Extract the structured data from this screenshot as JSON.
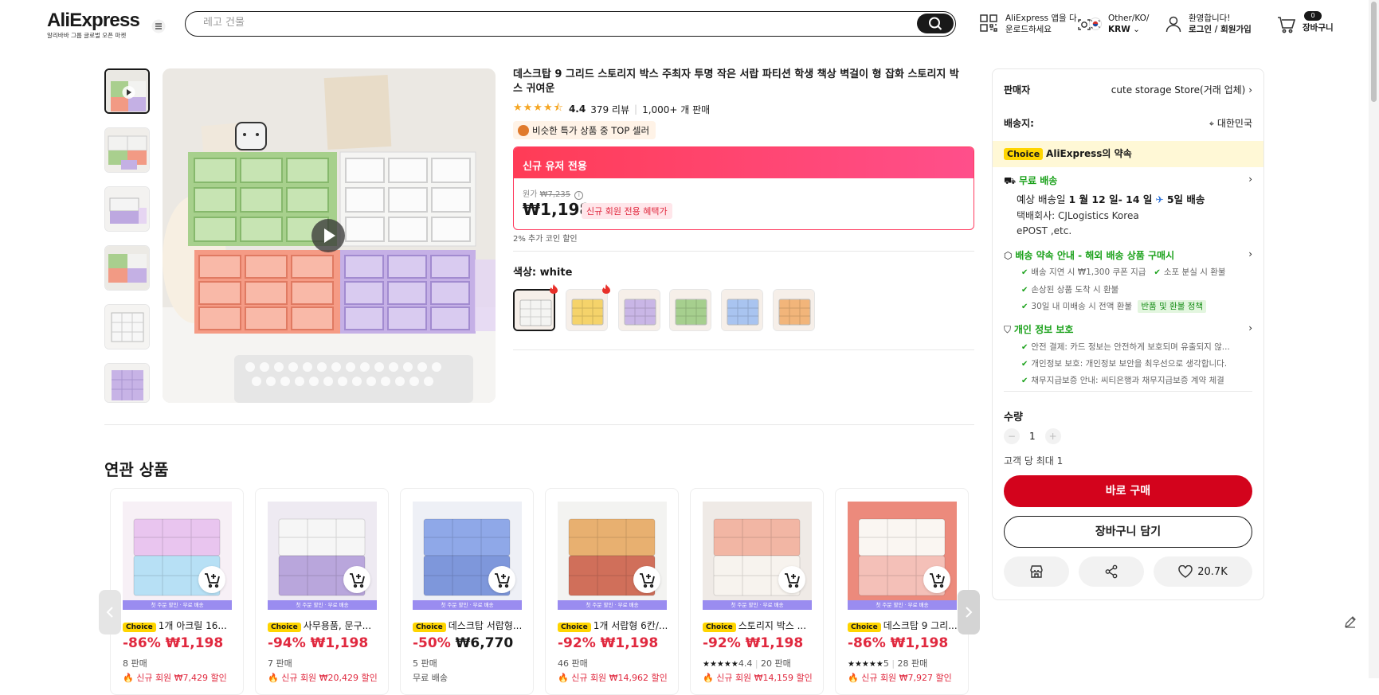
{
  "header": {
    "logo": "AliExpress",
    "logo_sub": "알리바바 그룹 글로벌 오픈 마켓",
    "search_placeholder": "레고 건물",
    "app_line1": "AliExpress 앱을 다",
    "app_line2": "운로드하세요",
    "region_line1": "Other/KO/",
    "region_line2": "KRW",
    "account_line1": "환영합니다!",
    "account_line2": "로그인 / 회원가입",
    "cart_count": "0",
    "cart_label": "장바구니"
  },
  "product": {
    "title": "데스크탑 9 그리드 스토리지 박스 주최자 투명 작은 서랍 파티션 학생 책상 벽걸이 형 잡화 스토리지 박스 귀여운",
    "rating": "4.4",
    "reviews": "379 리뷰",
    "sold": "1,000+ 개 판매",
    "top_seller": "비슷한 특가 상품 중 TOP 셀러",
    "promo_header": "신규 유저 전용",
    "orig_label": "원가",
    "orig_price": "₩7,235",
    "price": "₩1,198",
    "new_member_tag": "신규 회원 전용 혜택가",
    "coin_note": "2% 추가 코인 할인",
    "color_label": "색상: white",
    "swatches": [
      {
        "name": "white",
        "color": "#f4f4f2"
      },
      {
        "name": "yellow",
        "color": "#f5d36a"
      },
      {
        "name": "purple",
        "color": "#c9b6e6"
      },
      {
        "name": "green",
        "color": "#a6cf8e"
      },
      {
        "name": "blue",
        "color": "#a9c4f0"
      },
      {
        "name": "orange",
        "color": "#f2b57a"
      }
    ]
  },
  "panel": {
    "seller_label": "판매자",
    "seller_name": "cute storage Store(거래 업체)",
    "ship_to_label": "배송지:",
    "ship_to": "대한민국",
    "choice_badge": "Choice",
    "choice_promise": "AliExpress의 약속",
    "free_shipping": "무료 배송",
    "delivery_prefix": "예상 배송일 ",
    "delivery_dates": "1 월 12 일- 14 일",
    "delivery_speed": "5일 배송",
    "carrier_line1": "택배회사:  CJLogistics  Korea",
    "carrier_line2": "ePOST ,etc.",
    "guarantee_title": "배송 약속 안내 - 해외 배송 상품 구매시",
    "guarantees": [
      "배송 지연 시 ₩1,300 쿠폰 지급",
      "소포 분실 시 환불",
      "손상된 상품 도착 시 환불",
      "30일 내 미배송 시 전액 환불"
    ],
    "refund_policy": "반품 및 환불 정책",
    "privacy_title": "개인 정보 보호",
    "privacy_items": [
      "안전 결제: 카드 정보는 안전하게 보호되며 유출되지 않...",
      "개인정보 보호: 개인정보 보안을 최우선으로 생각합니다.",
      "채무지급보증 안내: 씨티은행과 채무지급보증 계약 체결"
    ],
    "qty_label": "수량",
    "qty_value": "1",
    "qty_limit": "고객 당 최대 1",
    "buy_now": "바로 구매",
    "add_to_cart": "장바구니 담기",
    "wish_count": "20.7K"
  },
  "related": {
    "title": "연관 상품",
    "band_text": "첫 주문 할인 · 무료 배송",
    "items": [
      {
        "name": "1개 아크릴 16...",
        "discount": "-86%",
        "price": "₩1,198",
        "sold": "8 판매",
        "coupon": "신규 회원 ₩7,429 할인",
        "bg": "#f7f0f6",
        "c1": "#e9c5ef",
        "c2": "#b7e0f5"
      },
      {
        "name": "사무용품, 문구...",
        "discount": "-94%",
        "price": "₩1,198",
        "sold": "7 판매",
        "coupon": "신규 회원 ₩20,429 할인",
        "bg": "#eeeaf2",
        "c1": "#f6f6f6",
        "c2": "#b9a6dc"
      },
      {
        "name": "데스크탑 서랍형...",
        "discount": "-50%",
        "price": "₩6,770",
        "sold": "5 판매",
        "coupon": "무료 배송",
        "bg": "#eef0f6",
        "c1": "#8fa8e8",
        "c2": "#7e97db"
      },
      {
        "name": "1개 서랍형 6칸/...",
        "discount": "-92%",
        "price": "₩1,198",
        "sold": "46 판매",
        "coupon": "신규 회원 ₩14,962 할인",
        "bg": "#f3f3f1",
        "c1": "#e8b070",
        "c2": "#d06f5a"
      },
      {
        "name": "스토리지 박스 ...",
        "discount": "-92%",
        "price": "₩1,198",
        "rating": "4.4",
        "sold": "20 판매",
        "coupon": "신규 회원 ₩14,159 할인",
        "bg": "#efeae6",
        "c1": "#f2b6a4",
        "c2": "#f7f3ee"
      },
      {
        "name": "데스크탑 9 그리...",
        "discount": "-86%",
        "price": "₩1,198",
        "rating": "5",
        "sold": "28 판매",
        "coupon": "신규 회원 ₩7,927 할인",
        "bg": "#ec8a7c",
        "c1": "#faf6f2",
        "c2": "#f4c0b8"
      }
    ]
  }
}
